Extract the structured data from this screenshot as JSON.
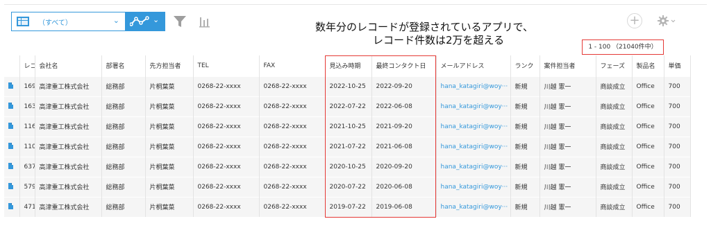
{
  "toolbar": {
    "view_label": "（すべて）",
    "view_chevron": "⌄",
    "graph_chevron": "⌄",
    "add_label": "+"
  },
  "annotation": {
    "line1": "数年分のレコードが登録されているアプリで、",
    "line2": "レコード件数は2万を超える"
  },
  "pager": {
    "text": "1 - 100 （21040件中）"
  },
  "table": {
    "headers": [
      "",
      "レコード番号",
      "会社名",
      "部署名",
      "先方担当者",
      "TEL",
      "FAX",
      "見込み時期",
      "最終コンタクト日",
      "メールアドレス",
      "ランク",
      "案件担当者",
      "フェーズ",
      "製品名",
      "単価"
    ],
    "rows": [
      [
        "",
        "169",
        "高津重工株式会社",
        "総務部",
        "片桐葉菜",
        "0268-22-xxxx",
        "0268-22-xxxx",
        "2022-10-25",
        "2022-09-20",
        "hana_katagiri@woy···",
        "新規",
        "川越 憲一",
        "商談成立",
        "Office",
        "700"
      ],
      [
        "",
        "163",
        "高津重工株式会社",
        "総務部",
        "片桐葉菜",
        "0268-22-xxxx",
        "0268-22-xxxx",
        "2022-07-22",
        "2022-06-08",
        "hana_katagiri@woy···",
        "新規",
        "川越 憲一",
        "商談成立",
        "Office",
        "700"
      ],
      [
        "",
        "116",
        "高津重工株式会社",
        "総務部",
        "片桐葉菜",
        "0268-22-xxxx",
        "0268-22-xxxx",
        "2021-10-25",
        "2021-09-20",
        "hana_katagiri@woy···",
        "新規",
        "川越 憲一",
        "商談成立",
        "Office",
        "700"
      ],
      [
        "",
        "110",
        "高津重工株式会社",
        "総務部",
        "片桐葉菜",
        "0268-22-xxxx",
        "0268-22-xxxx",
        "2021-07-22",
        "2021-06-08",
        "hana_katagiri@woy···",
        "新規",
        "川越 憲一",
        "商談成立",
        "Office",
        "700"
      ],
      [
        "",
        "637",
        "高津重工株式会社",
        "総務部",
        "片桐葉菜",
        "0268-22-xxxx",
        "0268-22-xxxx",
        "2020-10-25",
        "2020-09-20",
        "hana_katagiri@woy···",
        "新規",
        "川越 憲一",
        "商談成立",
        "Office",
        "700"
      ],
      [
        "",
        "579",
        "高津重工株式会社",
        "総務部",
        "片桐葉菜",
        "0268-22-xxxx",
        "0268-22-xxxx",
        "2020-07-22",
        "2020-06-08",
        "hana_katagiri@woy···",
        "新規",
        "川越 憲一",
        "商談成立",
        "Office",
        "700"
      ],
      [
        "",
        "471",
        "高津重工株式会社",
        "総務部",
        "片桐葉菜",
        "0268-22-xxxx",
        "0268-22-xxxx",
        "2019-07-22",
        "2019-06-08",
        "hana_katagiri@woy···",
        "新規",
        "川越 憲一",
        "商談成立",
        "Office",
        "700"
      ]
    ]
  },
  "colors": {
    "accent": "#3498db",
    "highlight": "#e53935",
    "row_background": "#f5f5f5"
  },
  "icons": [
    "table-view-icon",
    "graph-icon",
    "filter-icon",
    "bar-chart-icon",
    "plus-icon",
    "gear-icon",
    "record-detail-icon"
  ]
}
